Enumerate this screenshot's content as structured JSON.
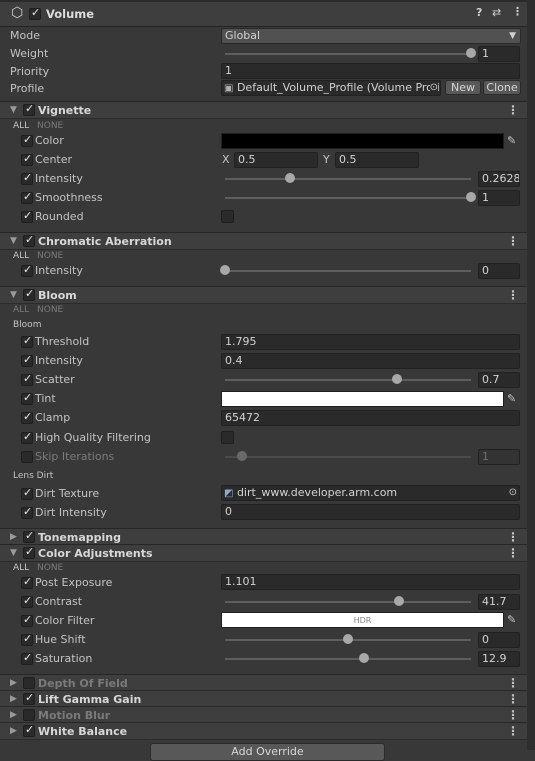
{
  "header": {
    "title": "Volume",
    "help_icon": "?",
    "settings_icon": "⇄",
    "menu_icon": "⋮"
  },
  "volume": {
    "mode_label": "Mode",
    "mode_value": "Global",
    "weight_label": "Weight",
    "weight_value": "1",
    "weight_fraction": 1.0,
    "priority_label": "Priority",
    "priority_value": "1",
    "profile_label": "Profile",
    "profile_value": "Default_Volume_Profile (Volume Profile",
    "new_label": "New",
    "clone_label": "Clone"
  },
  "common": {
    "all": "ALL",
    "none": "NONE",
    "kebab": "⋮"
  },
  "vignette": {
    "title": "Vignette",
    "color_label": "Color",
    "color_hex": "#000000",
    "center_label": "Center",
    "x_label": "X",
    "x_value": "0.5",
    "y_label": "Y",
    "y_value": "0.5",
    "intensity_label": "Intensity",
    "intensity_value": "0.2628",
    "intensity_fraction": 0.2628,
    "smoothness_label": "Smoothness",
    "smoothness_value": "1",
    "smoothness_fraction": 1.0,
    "rounded_label": "Rounded"
  },
  "chromatic": {
    "title": "Chromatic Aberration",
    "intensity_label": "Intensity",
    "intensity_value": "0",
    "intensity_fraction": 0.0
  },
  "bloom": {
    "title": "Bloom",
    "group_label": "Bloom",
    "threshold_label": "Threshold",
    "threshold_value": "1.795",
    "intensity_label": "Intensity",
    "intensity_value": "0.4",
    "scatter_label": "Scatter",
    "scatter_value": "0.7",
    "scatter_fraction": 0.7,
    "tint_label": "Tint",
    "tint_hex": "#ffffff",
    "clamp_label": "Clamp",
    "clamp_value": "65472",
    "hq_label": "High Quality Filtering",
    "skip_label": "Skip Iterations",
    "skip_value": "1",
    "skip_fraction": 0.07,
    "lens_dirt_label": "Lens Dirt",
    "dirt_texture_label": "Dirt Texture",
    "dirt_texture_value": "dirt_www.developer.arm.com",
    "dirt_intensity_label": "Dirt Intensity",
    "dirt_intensity_value": "0"
  },
  "tonemapping": {
    "title": "Tonemapping"
  },
  "color_adjustments": {
    "title": "Color Adjustments",
    "post_exposure_label": "Post Exposure",
    "post_exposure_value": "1.101",
    "contrast_label": "Contrast",
    "contrast_value": "41.7",
    "contrast_fraction": 0.7085,
    "color_filter_label": "Color Filter",
    "color_filter_hex": "#ffffff",
    "hdr_label": "HDR",
    "hue_shift_label": "Hue Shift",
    "hue_shift_value": "0",
    "hue_shift_fraction": 0.5,
    "saturation_label": "Saturation",
    "saturation_value": "12.9",
    "saturation_fraction": 0.5645
  },
  "collapsed": {
    "depth_of_field": "Depth Of Field",
    "lift_gamma_gain": "Lift Gamma Gain",
    "motion_blur": "Motion Blur",
    "white_balance": "White Balance"
  },
  "footer": {
    "add_override": "Add Override"
  }
}
